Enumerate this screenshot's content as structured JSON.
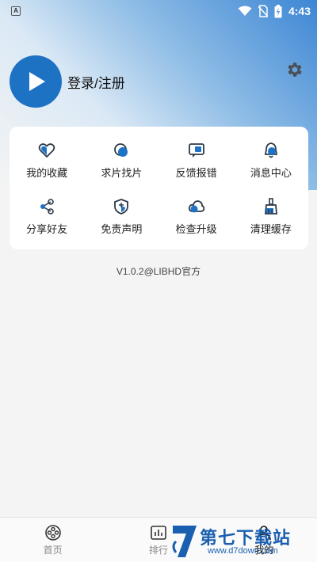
{
  "status_bar": {
    "app_badge": "A",
    "time": "4:43"
  },
  "profile": {
    "login_label": "登录/注册"
  },
  "menu": [
    {
      "label": "我的收藏",
      "icon": "heart-icon"
    },
    {
      "label": "求片找片",
      "icon": "search-film-icon"
    },
    {
      "label": "反馈报错",
      "icon": "feedback-icon"
    },
    {
      "label": "消息中心",
      "icon": "bell-icon"
    },
    {
      "label": "分享好友",
      "icon": "share-icon"
    },
    {
      "label": "免责声明",
      "icon": "shield-icon"
    },
    {
      "label": "检查升级",
      "icon": "cloud-icon"
    },
    {
      "label": "清理缓存",
      "icon": "broom-icon"
    }
  ],
  "version": "V1.0.2@LIBHD官方",
  "bottom_nav": [
    {
      "label": "首页",
      "icon": "film-reel-icon"
    },
    {
      "label": "排行",
      "icon": "bar-chart-icon"
    },
    {
      "label": "我的",
      "icon": "user-icon"
    }
  ],
  "watermark": {
    "title": "第七下载站",
    "url": "www.d7down.com"
  },
  "colors": {
    "accent": "#1e72c4",
    "icon_dark": "#2b3a4a"
  }
}
